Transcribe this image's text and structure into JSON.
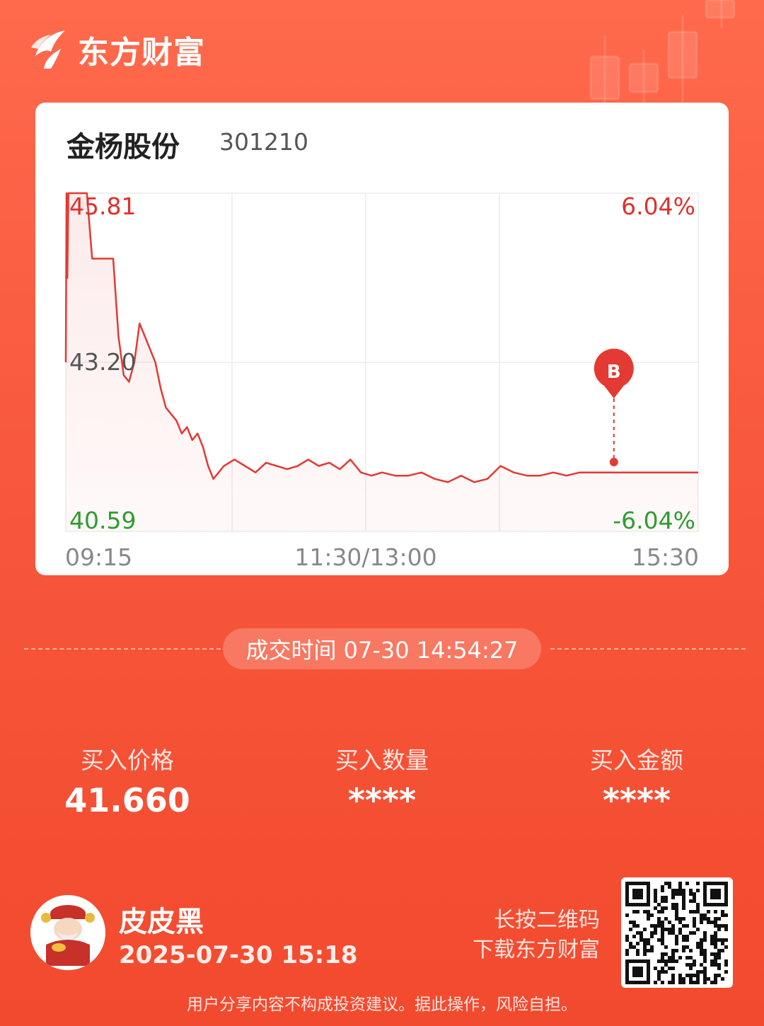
{
  "header": {
    "brand_name": "东方财富"
  },
  "stock": {
    "name": "金杨股份",
    "code": "301210"
  },
  "chart_data": {
    "type": "line",
    "title": "",
    "y_labels": {
      "top": "45.81",
      "mid": "43.20",
      "bottom": "40.59"
    },
    "pct_labels": {
      "top": "6.04%",
      "bottom": "-6.04%"
    },
    "x_tick_labels": [
      "09:15",
      "11:30/13:00",
      "15:30"
    ],
    "ylim": [
      40.59,
      45.81
    ],
    "reference_price": 43.2,
    "x_minutes_range": [
      0,
      240
    ],
    "series": [
      {
        "x": [
          0,
          0.3,
          0.6,
          1,
          3,
          6,
          8,
          10,
          12,
          13.5,
          15,
          16.5,
          18,
          20,
          22,
          24,
          26,
          28,
          30,
          32,
          34,
          36,
          38,
          40,
          42,
          44,
          46,
          48,
          50,
          52,
          54,
          56,
          58,
          60,
          64,
          68,
          72,
          76,
          80,
          84,
          88,
          92,
          96,
          100,
          104,
          108,
          112,
          116,
          120,
          125,
          130,
          135,
          140,
          145,
          150,
          155,
          160,
          165,
          170,
          175,
          180,
          185,
          190,
          195,
          200,
          205,
          210,
          215,
          220,
          225,
          230,
          235,
          240
        ],
        "values": [
          43.2,
          45.81,
          44.5,
          45.81,
          45.81,
          45.81,
          45.81,
          44.8,
          44.8,
          44.8,
          44.8,
          44.8,
          44.8,
          43.6,
          43.0,
          42.9,
          43.2,
          43.8,
          43.6,
          43.4,
          43.2,
          42.8,
          42.5,
          42.4,
          42.3,
          42.1,
          42.2,
          42.0,
          42.1,
          41.9,
          41.6,
          41.4,
          41.5,
          41.6,
          41.7,
          41.6,
          41.5,
          41.65,
          41.6,
          41.55,
          41.6,
          41.7,
          41.6,
          41.65,
          41.55,
          41.7,
          41.5,
          41.45,
          41.5,
          41.45,
          41.45,
          41.5,
          41.4,
          41.35,
          41.45,
          41.35,
          41.4,
          41.6,
          41.5,
          41.45,
          41.45,
          41.5,
          41.45,
          41.5,
          41.5,
          41.5,
          41.5,
          41.5,
          41.5,
          41.5,
          41.5,
          41.5,
          41.5
        ]
      }
    ],
    "marker": {
      "label": "B",
      "x": 208,
      "price": 41.66
    }
  },
  "trade": {
    "time_label": "成交时间 07-30 14:54:27"
  },
  "stats": [
    {
      "label": "买入价格",
      "value": "41.660"
    },
    {
      "label": "买入数量",
      "value": "****"
    },
    {
      "label": "买入金额",
      "value": "****"
    }
  ],
  "user": {
    "name": "皮皮黑",
    "share_date": "2025-07-30 15:18"
  },
  "qr": {
    "hint_line1": "长按二维码",
    "hint_line2": "下载东方财富"
  },
  "footer": {
    "disclaimer": "用户分享内容不构成投资建议。据此操作，风险自担。"
  },
  "colors": {
    "up": "#e0302a",
    "down": "#2e9c2e",
    "neutral": "#555555",
    "line": "#e33a33"
  }
}
